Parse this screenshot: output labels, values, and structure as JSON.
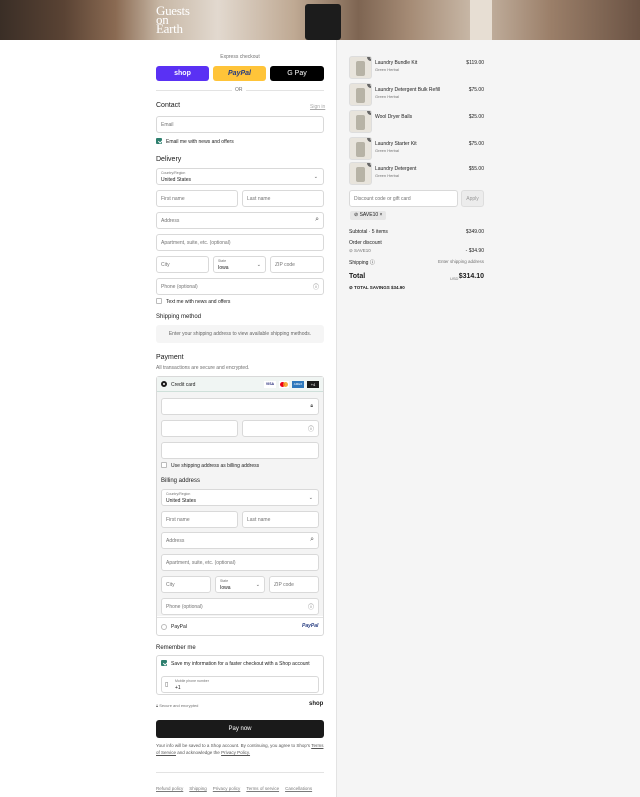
{
  "brand": {
    "line1": "Guests",
    "line2": "on",
    "line3": "Earth"
  },
  "express": {
    "title": "Express checkout",
    "shop": "shop",
    "paypal": "PayPal",
    "gpay": "G Pay",
    "or": "OR"
  },
  "contact": {
    "title": "Contact",
    "signin": "Sign in",
    "email_placeholder": "Email",
    "news": "Email me with news and offers"
  },
  "delivery": {
    "title": "Delivery",
    "country_label": "Country/Region",
    "country": "United States",
    "first": "First name",
    "last": "Last name",
    "address": "Address",
    "apt": "Apartment, suite, etc. (optional)",
    "city": "City",
    "state_label": "State",
    "state": "Iowa",
    "zip": "ZIP code",
    "phone": "Phone (optional)",
    "text_news": "Text me with news and offers"
  },
  "shipping": {
    "title": "Shipping method",
    "msg": "Enter your shipping address to view available shipping methods."
  },
  "payment": {
    "title": "Payment",
    "sub": "All transactions are secure and encrypted.",
    "credit": "Credit card",
    "more": "+4",
    "use_shipping": "Use shipping address as billing address",
    "billing_title": "Billing address",
    "paypal_label": "PayPal",
    "paypal_logo": "PayPal",
    "cards": [
      "VISA",
      "MC",
      "AMEX"
    ]
  },
  "billing": {
    "country_label": "Country/Region",
    "country": "United States",
    "first": "First name",
    "last": "Last name",
    "address": "Address",
    "apt": "Apartment, suite, etc. (optional)",
    "city": "City",
    "state_label": "State",
    "state": "Iowa",
    "zip": "ZIP code",
    "phone": "Phone (optional)"
  },
  "remember": {
    "title": "Remember me",
    "save": "Save my information for a faster checkout with a Shop account",
    "mobile_label": "Mobile phone number",
    "mobile": "+1",
    "secure": "Secure and encrypted",
    "shop": "shop"
  },
  "pay_now": "Pay now",
  "legal": {
    "text": "Your info will be saved to a Shop account. By continuing, you agree to Shop's",
    "tos": "Terms of Service",
    "and": "and acknowledge the",
    "privacy": "Privacy Policy."
  },
  "footer": [
    "Refund policy",
    "Shipping",
    "Privacy policy",
    "Terms of service",
    "Cancellations"
  ],
  "items": [
    {
      "qty": "1",
      "name": "Laundry Bundle Kit",
      "sub": "Green Herbal",
      "price": "$119.00"
    },
    {
      "qty": "1",
      "name": "Laundry Detergent Bulk Refill",
      "sub": "Green Herbal",
      "price": "$75.00"
    },
    {
      "qty": "1",
      "name": "Wool Dryer Balls",
      "sub": "",
      "price": "$25.00"
    },
    {
      "qty": "1",
      "name": "Laundry Starter Kit",
      "sub": "Green Herbal",
      "price": "$75.00"
    },
    {
      "qty": "1",
      "name": "Laundry Detergent",
      "sub": "Green Herbal",
      "price": "$55.00"
    }
  ],
  "summary": {
    "discount_placeholder": "Discount code or gift card",
    "apply": "Apply",
    "code": "SAVE10",
    "subtotal_label": "Subtotal · 5 items",
    "subtotal": "$349.00",
    "order_discount": "Order discount",
    "code_line": "SAVE10",
    "discount": "- $34.90",
    "shipping_label": "Shipping",
    "shipping": "Enter shipping address",
    "total_label": "Total",
    "currency": "USD",
    "total": "$314.10",
    "savings": "TOTAL SAVINGS  $34.90"
  },
  "colors": {
    "shop": "#5a31f4",
    "paypal": "#ffc439",
    "pay": "#1a1a1a",
    "accent": "#2e7f6e"
  }
}
